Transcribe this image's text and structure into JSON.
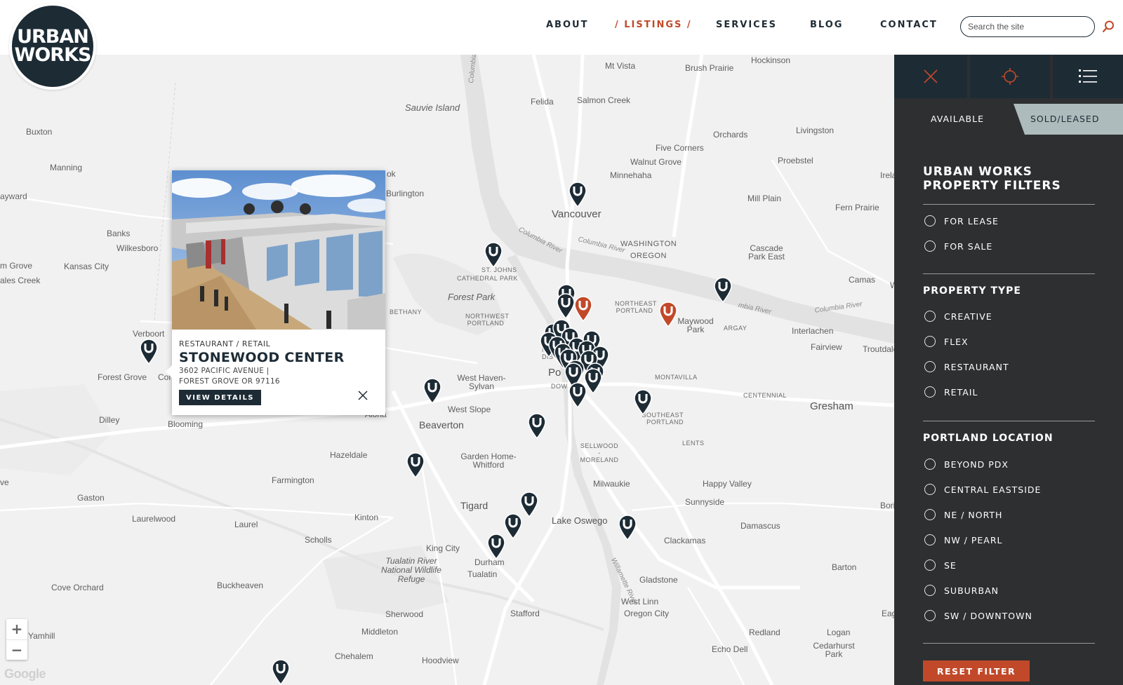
{
  "brand": {
    "line1": "URBAN",
    "line2": "WORKS"
  },
  "nav": {
    "about": "ABOUT",
    "listings": "/ LISTINGS /",
    "services": "SERVICES",
    "blog": "BLOG",
    "contact": "CONTACT"
  },
  "search": {
    "placeholder": "Search the site",
    "icon": "search-icon"
  },
  "map": {
    "places": {
      "mt_vista": "Mt Vista",
      "brush_prairie": "Brush Prairie",
      "hockinson": "Hockinson",
      "sauvie_island": "Sauvie Island",
      "felida": "Felida",
      "salmon_creek": "Salmon Creek",
      "buxton": "Buxton",
      "orchards": "Orchards",
      "livingston": "Livingston",
      "five_corners": "Five Corners",
      "manning": "Manning",
      "walnut_grove": "Walnut Grove",
      "proebstel": "Proebstel",
      "minnehaha": "Minnehaha",
      "irela": "Irela",
      "hayward": "ayward",
      "burlington": "Burlington",
      "ok": "ok",
      "mill_plain": "Mill Plain",
      "fern_prairie": "Fern Prairie",
      "vancouver": "Vancouver",
      "banks": "Banks",
      "wilkesboro": "Wilkesboro",
      "washington": "WASHINGTON",
      "oregon": "OREGON",
      "cascade_park": "Cascade Park East",
      "m_grove": "m Grove",
      "kansas_city": "Kansas City",
      "st_johns": "ST. JOHNS",
      "cathedral_park": "CATHEDRAL PARK",
      "ales_creek": "ales Creek",
      "camas": "Camas",
      "w_cut": "W",
      "forest_park": "Forest Park",
      "northeast_portland": "NORTHEAST PORTLAND",
      "bethany": "BETHANY",
      "northwest_portland": "NORTHWEST PORTLAND",
      "maywood_park": "Maywood Park",
      "argay": "ARGAY",
      "interlachen": "Interlachen",
      "verboort": "Verboort",
      "fairview": "Fairview",
      "troutdale": "Troutdale",
      "nw_dis": "NW DIS",
      "forest_grove": "Forest Grove",
      "cor": "Cor",
      "west_haven": "West Haven-Sylvan",
      "po": "Po",
      "dow": "DOW",
      "montavilla": "MONTAVILLA",
      "centennial": "CENTENNIAL",
      "gresham": "Gresham",
      "dilley": "Dilley",
      "blooming": "Blooming",
      "aloha": "Aloha",
      "west_slope": "West Slope",
      "beaverton": "Beaverton",
      "se_portland": "SOUTHEAST PORTLAND",
      "lents": "LENTS",
      "sellwood": "SELLWOOD - MORELAND",
      "hazeldale": "Hazeldale",
      "garden_home": "Garden Home-Whitford",
      "farmington": "Farmington",
      "milwaukie": "Milwaukie",
      "happy_valley": "Happy Valley",
      "ve": "ve",
      "gaston": "Gaston",
      "sunnyside": "Sunnyside",
      "tigard": "Tigard",
      "borin": "Borin",
      "laurelwood": "Laurelwood",
      "laurel": "Laurel",
      "kinton": "Kinton",
      "lake_oswego": "Lake Oswego",
      "damascus": "Damascus",
      "scholls": "Scholls",
      "clackamas": "Clackamas",
      "king_city": "King City",
      "tualatin_refuge": "Tualatin River National Wildlife Refuge",
      "durham": "Durham",
      "barton": "Barton",
      "cove_orchard": "Cove Orchard",
      "buckheaven": "Buckheaven",
      "tualatin": "Tualatin",
      "gladstone": "Gladstone",
      "west_linn": "West Linn",
      "oregon_city": "Oregon City",
      "sherwood": "Sherwood",
      "stafford": "Stafford",
      "eag": "Eag",
      "yamhill": "Yamhill",
      "middleton": "Middleton",
      "redland": "Redland",
      "logan": "Logan",
      "echo_dell": "Echo Dell",
      "cedarhurst": "Cedarhurst Park",
      "chehalem": "Chehalem",
      "hoodview": "Hoodview"
    },
    "rivers": {
      "columbia1": "Columbia River",
      "columbia2": "Columbia River",
      "columbia3": "mbia River",
      "columbia4": "Columbia River",
      "columbia5": "Columbia River",
      "willamette": "Willamette River"
    },
    "zoom_in": "+",
    "zoom_out": "−",
    "attribution": "Google",
    "colors": {
      "pin_dark": "#1d2b35",
      "pin_active": "#c1492a"
    }
  },
  "popup": {
    "category": "RESTAURANT / RETAIL",
    "title": "STONEWOOD CENTER",
    "address_line1": "3602 PACIFIC AVENUE |",
    "address_line2": "FOREST GROVE OR 97116",
    "button": "VIEW DETAILS",
    "close_icon": "close-icon"
  },
  "panel": {
    "tools": [
      "close-icon",
      "locate-icon",
      "list-icon"
    ],
    "tab_available": "AVAILABLE",
    "tab_sold": "SOLD/LEASED",
    "heading": "URBAN WORKS PROPERTY FILTERS",
    "listing_type": [
      "FOR LEASE",
      "FOR SALE"
    ],
    "property_type_title": "PROPERTY TYPE",
    "property_types": [
      "CREATIVE",
      "FLEX",
      "RESTAURANT",
      "RETAIL"
    ],
    "location_title": "PORTLAND LOCATION",
    "locations": [
      "BEYOND PDX",
      "CENTRAL EASTSIDE",
      "NE / NORTH",
      "NW / PEARL",
      "SE",
      "SUBURBAN",
      "SW / DOWNTOWN"
    ],
    "reset": "RESET FILTER",
    "colors": {
      "panel_bg": "#2d2f31",
      "accent": "#c1492a",
      "tab_sold_bg": "#aebbbc"
    }
  }
}
